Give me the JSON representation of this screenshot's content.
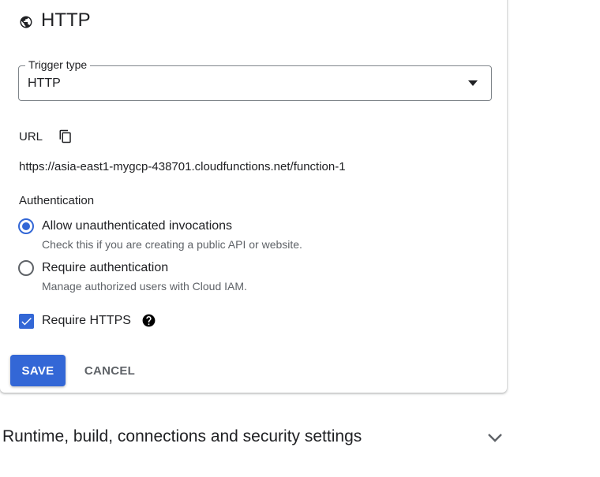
{
  "header": {
    "title": "HTTP",
    "icon": "globe-icon"
  },
  "trigger": {
    "legend": "Trigger type",
    "value": "HTTP"
  },
  "url": {
    "label": "URL",
    "value": "https://asia-east1-mygcp-438701.cloudfunctions.net/function-1"
  },
  "authentication": {
    "label": "Authentication",
    "options": [
      {
        "title": "Allow unauthenticated invocations",
        "subtitle": "Check this if you are creating a public API or website.",
        "selected": true
      },
      {
        "title": "Require authentication",
        "subtitle": "Manage authorized users with Cloud IAM.",
        "selected": false
      }
    ]
  },
  "https": {
    "label": "Require HTTPS",
    "checked": true
  },
  "actions": {
    "save": "SAVE",
    "cancel": "CANCEL"
  },
  "section": {
    "title": "Runtime, build, connections and security settings"
  },
  "colors": {
    "accent": "#3367d6"
  }
}
